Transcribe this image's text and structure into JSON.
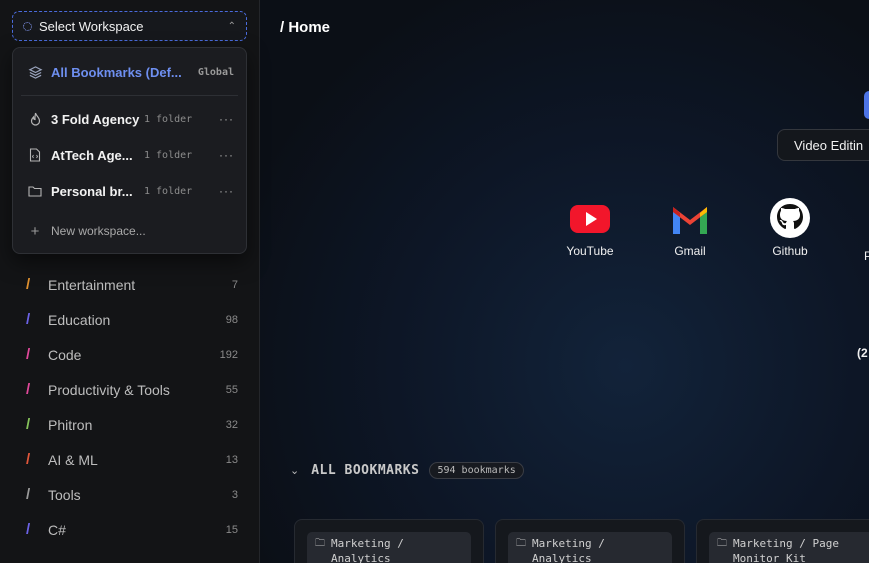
{
  "workspace_select": {
    "label": "Select Workspace"
  },
  "dropdown": {
    "global": {
      "name": "All Bookmarks (Def...",
      "tag": "Global"
    },
    "workspaces": [
      {
        "name": "3 Fold Agency",
        "meta": "1 folder",
        "icon": "flame-icon"
      },
      {
        "name": "AtTech Age...",
        "meta": "1 folder",
        "icon": "code-file-icon"
      },
      {
        "name": "Personal br...",
        "meta": "1 folder",
        "icon": "folder-icon"
      }
    ],
    "new_workspace": "New workspace..."
  },
  "categories": [
    {
      "name": "Entertainment",
      "count": "7",
      "color": "#e0912f"
    },
    {
      "name": "Education",
      "count": "98",
      "color": "#6b62e6"
    },
    {
      "name": "Code",
      "count": "192",
      "color": "#e0489a"
    },
    {
      "name": "Productivity & Tools",
      "count": "55",
      "color": "#e0489a"
    },
    {
      "name": "Phitron",
      "count": "32",
      "color": "#86c35b"
    },
    {
      "name": "AI & ML",
      "count": "13",
      "color": "#e0563a"
    },
    {
      "name": "Tools",
      "count": "3",
      "color": "#9a9a9a"
    },
    {
      "name": "C#",
      "count": "15",
      "color": "#6b62e6"
    }
  ],
  "main": {
    "breadcrumb": "/ Home",
    "pill": "Video Editin",
    "shortcuts": [
      {
        "label": "YouTube",
        "icon": "youtube-icon"
      },
      {
        "label": "Gmail",
        "icon": "gmail-icon"
      },
      {
        "label": "Github",
        "icon": "github-icon"
      }
    ],
    "cut_p": "P",
    "cut_two": "(2",
    "all_bookmarks": {
      "title": "ALL BOOKMARKS",
      "count": "594 bookmarks"
    },
    "cards": [
      {
        "line1": "Marketing /",
        "line2": "Analytics"
      },
      {
        "line1": "Marketing /",
        "line2": "Analytics"
      },
      {
        "line1": "Marketing / Page",
        "line2": "Monitor Kit"
      }
    ]
  }
}
